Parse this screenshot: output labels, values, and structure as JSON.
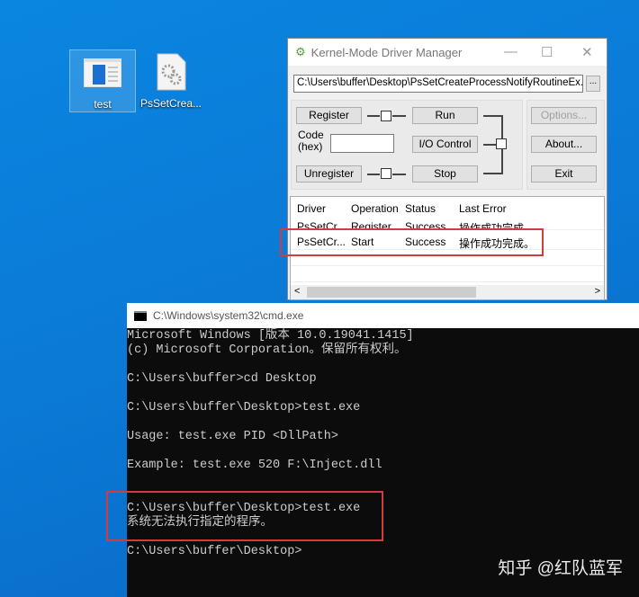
{
  "desktop": {
    "icons": [
      {
        "label": "test"
      },
      {
        "label": "PsSetCrea..."
      }
    ]
  },
  "driver_manager": {
    "title": "Kernel-Mode Driver Manager",
    "path": "C:\\Users\\buffer\\Desktop\\PsSetCreateProcessNotifyRoutineEx.sys",
    "browse": "...",
    "buttons": {
      "register": "Register",
      "unregister": "Unregister",
      "run": "Run",
      "io_control": "I/O Control",
      "stop": "Stop",
      "options": "Options...",
      "about": "About...",
      "exit": "Exit"
    },
    "code_label_1": "Code",
    "code_label_2": "(hex)",
    "code_value": "",
    "columns": [
      "Driver",
      "Operation",
      "Status",
      "Last Error"
    ],
    "rows": [
      {
        "driver": "PsSetCr",
        "operation": "Register",
        "status": "Success",
        "error": "操作成功完成。"
      },
      {
        "driver": "PsSetCr...",
        "operation": "Start",
        "status": "Success",
        "error": "操作成功完成。"
      }
    ]
  },
  "cmd": {
    "title": "C:\\Windows\\system32\\cmd.exe",
    "lines": [
      "Microsoft Windows [版本 10.0.19041.1415]",
      "(c) Microsoft Corporation。保留所有权利。",
      "",
      "C:\\Users\\buffer>cd Desktop",
      "",
      "C:\\Users\\buffer\\Desktop>test.exe",
      "",
      "Usage: test.exe PID <DllPath>",
      "",
      "Example: test.exe 520 F:\\Inject.dll",
      "",
      "",
      "C:\\Users\\buffer\\Desktop>test.exe",
      "系统无法执行指定的程序。",
      "",
      "C:\\Users\\buffer\\Desktop>"
    ]
  },
  "watermark": "知乎 @红队蓝军"
}
